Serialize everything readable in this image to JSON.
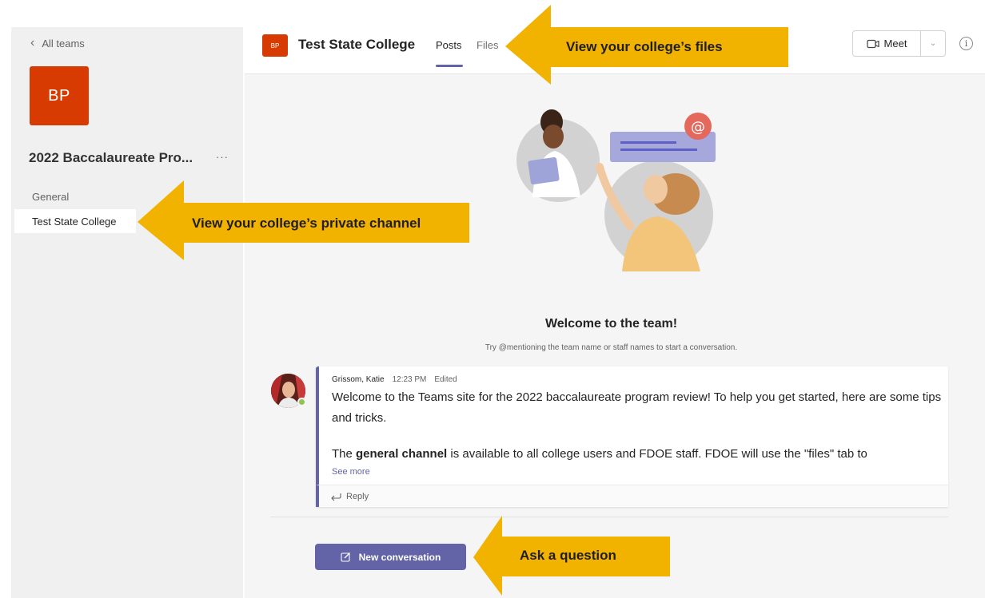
{
  "sidebar": {
    "back_label": "All teams",
    "team_initials": "BP",
    "team_name": "2022 Baccalaureate Pro...",
    "more_label": "···",
    "channels": [
      {
        "label": "General"
      },
      {
        "label": "Test State College"
      }
    ]
  },
  "header": {
    "avatar_initials": "BP",
    "title": "Test State College",
    "tabs": [
      {
        "label": "Posts"
      },
      {
        "label": "Files"
      }
    ],
    "meet_label": "Meet",
    "info_label": "i"
  },
  "welcome": {
    "title": "Welcome to the team!",
    "subtitle": "Try @mentioning the team name or staff names to start a conversation."
  },
  "message": {
    "author": "Grissom, Katie",
    "time": "12:23 PM",
    "status": "Edited",
    "paragraph1": "Welcome to the Teams site for the 2022 baccalaureate program review! To help you get started, here are some tips and tricks.",
    "p2_prefix": "The ",
    "p2_bold": "general channel",
    "p2_suffix": " is available to all college users and FDOE staff. FDOE will use the \"files\" tab to",
    "see_more": "See more",
    "reply_label": "Reply"
  },
  "compose": {
    "new_conversation_label": "New conversation"
  },
  "callouts": [
    {
      "label": "View your college’s files"
    },
    {
      "label": "View your college’s private channel"
    },
    {
      "label": "Ask a question"
    }
  ],
  "colors": {
    "accent": "#6264a7",
    "team_color": "#d83b01",
    "callout": "#f2b200",
    "presence": "#92c353"
  }
}
